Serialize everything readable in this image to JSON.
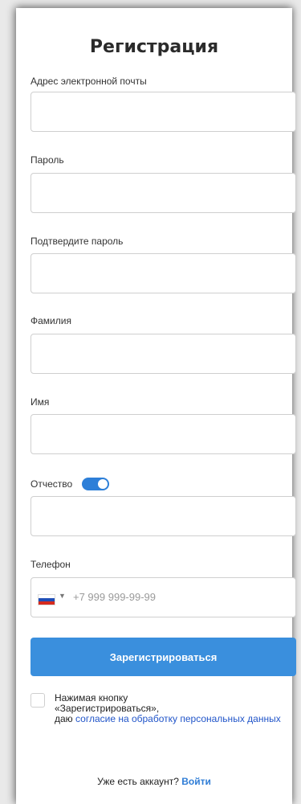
{
  "form": {
    "title": "Регистрация",
    "fields": {
      "email_label": "Адрес электронной почты",
      "password_label": "Пароль",
      "confirm_label": "Подтвердите пароль",
      "lastname_label": "Фамилия",
      "firstname_label": "Имя",
      "middlename_label": "Отчество",
      "phone_label": "Телефон",
      "phone_placeholder": "+7 999 999-99-99"
    },
    "middlename_toggle_on": true,
    "phone_country_flag": "russia-flag-icon",
    "submit_label": "Зарегистрироваться",
    "consent": {
      "line1": "Нажимая кнопку",
      "line2": "«Зарегистрироваться»,",
      "line3_prefix": "даю ",
      "link_text": "согласие на обработку персональных данных"
    },
    "footer": {
      "text": "Уже есть аккаунт? ",
      "link": "Войти"
    }
  },
  "colors": {
    "primary": "#3a8fdd",
    "link": "#2155c9",
    "toggle": "#2d7fd8"
  }
}
